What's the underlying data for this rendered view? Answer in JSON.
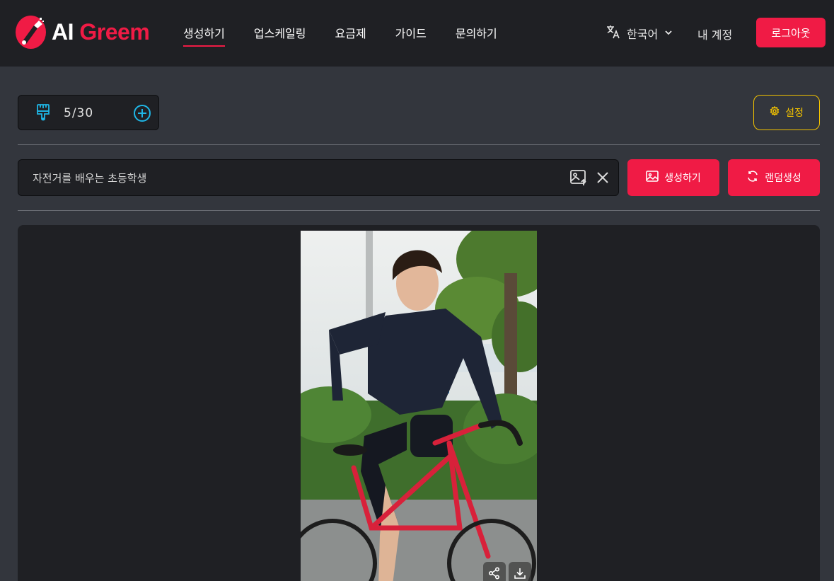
{
  "logo": {
    "ai": "AI",
    "greem": "Greem"
  },
  "nav": {
    "items": [
      {
        "label": "생성하기",
        "active": true
      },
      {
        "label": "업스케일링",
        "active": false
      },
      {
        "label": "요금제",
        "active": false
      },
      {
        "label": "가이드",
        "active": false
      },
      {
        "label": "문의하기",
        "active": false
      }
    ]
  },
  "header": {
    "language": "한국어",
    "account": "내 계정",
    "logout": "로그아웃"
  },
  "credits": {
    "value": "5/30"
  },
  "settings": {
    "label": "설정"
  },
  "prompt": {
    "value": "자전거를 배우는 초등학생"
  },
  "actions": {
    "generate": "생성하기",
    "random": "랜덤생성"
  },
  "colors": {
    "accent": "#f01b45",
    "settings": "#f2c200",
    "plus": "#1fb6e6"
  },
  "icons": [
    "brush-icon",
    "plus-circle-icon",
    "gear-icon",
    "translate-icon",
    "chevron-down-icon",
    "image-upload-icon",
    "close-icon",
    "image-icon",
    "refresh-icon",
    "share-icon",
    "download-icon"
  ]
}
